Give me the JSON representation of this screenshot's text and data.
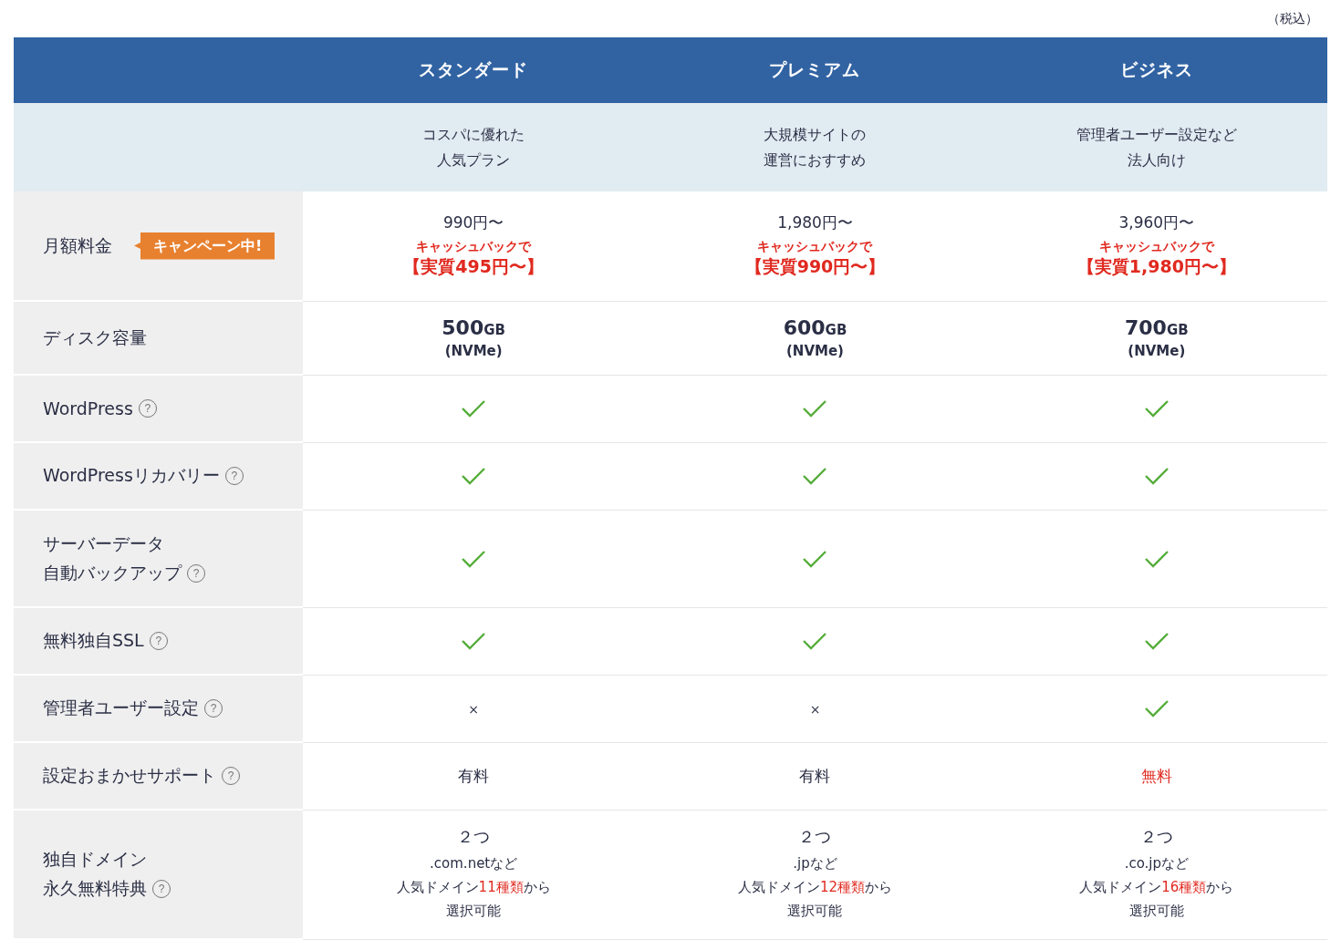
{
  "tax_note": "（税込）",
  "plans": [
    {
      "name": "スタンダード",
      "tagline": [
        "コスパに優れた",
        "人気プラン"
      ]
    },
    {
      "name": "プレミアム",
      "tagline": [
        "大規模サイトの",
        "運営におすすめ"
      ]
    },
    {
      "name": "ビジネス",
      "tagline": [
        "管理者ユーザー設定など",
        "法人向け"
      ]
    }
  ],
  "rows": [
    {
      "label": [
        "月額料金"
      ],
      "badge": "キャンペーン中!",
      "cells": [
        {
          "kind": "price",
          "price": "990円〜",
          "cashback": "キャッシュバックで",
          "effective": "【実質495円〜】"
        },
        {
          "kind": "price",
          "price": "1,980円〜",
          "cashback": "キャッシュバックで",
          "effective": "【実質990円〜】"
        },
        {
          "kind": "price",
          "price": "3,960円〜",
          "cashback": "キャッシュバックで",
          "effective": "【実質1,980円〜】"
        }
      ]
    },
    {
      "label": [
        "ディスク容量"
      ],
      "cells": [
        {
          "kind": "disk",
          "amount": "500",
          "unit": "GB",
          "note": "(NVMe)"
        },
        {
          "kind": "disk",
          "amount": "600",
          "unit": "GB",
          "note": "(NVMe)"
        },
        {
          "kind": "disk",
          "amount": "700",
          "unit": "GB",
          "note": "(NVMe)"
        }
      ]
    },
    {
      "label": [
        "WordPress"
      ],
      "help": "?",
      "cells": [
        {
          "kind": "check"
        },
        {
          "kind": "check"
        },
        {
          "kind": "check"
        }
      ]
    },
    {
      "label": [
        "WordPressリカバリー"
      ],
      "help": "?",
      "cells": [
        {
          "kind": "check"
        },
        {
          "kind": "check"
        },
        {
          "kind": "check"
        }
      ]
    },
    {
      "label": [
        "サーバーデータ",
        "自動バックアップ"
      ],
      "help": "?",
      "cells": [
        {
          "kind": "check"
        },
        {
          "kind": "check"
        },
        {
          "kind": "check"
        }
      ]
    },
    {
      "label": [
        "無料独自SSL"
      ],
      "help": "?",
      "cells": [
        {
          "kind": "check"
        },
        {
          "kind": "check"
        },
        {
          "kind": "check"
        }
      ]
    },
    {
      "label": [
        "管理者ユーザー設定"
      ],
      "help": "?",
      "cells": [
        {
          "kind": "cross",
          "text": "×"
        },
        {
          "kind": "cross",
          "text": "×"
        },
        {
          "kind": "check"
        }
      ]
    },
    {
      "label": [
        "設定おまかせサポート"
      ],
      "help": "?",
      "cells": [
        {
          "kind": "text",
          "text": "有料",
          "highlight": false
        },
        {
          "kind": "text",
          "text": "有料",
          "highlight": false
        },
        {
          "kind": "text",
          "text": "無料",
          "highlight": true
        }
      ]
    },
    {
      "label": [
        "独自ドメイン",
        "永久無料特典"
      ],
      "help": "?",
      "cells": [
        {
          "kind": "domain",
          "count": "２つ",
          "examples": ".com.netなど",
          "variety": "人気ドメイン**11種類**から",
          "note": "選択可能"
        },
        {
          "kind": "domain",
          "count": "２つ",
          "examples": ".jpなど",
          "variety": "人気ドメイン**12種類**から",
          "note": "選択可能"
        },
        {
          "kind": "domain",
          "count": "２つ",
          "examples": ".co.jpなど",
          "variety": "人気ドメイン**16種類**から",
          "note": "選択可能"
        }
      ]
    }
  ]
}
